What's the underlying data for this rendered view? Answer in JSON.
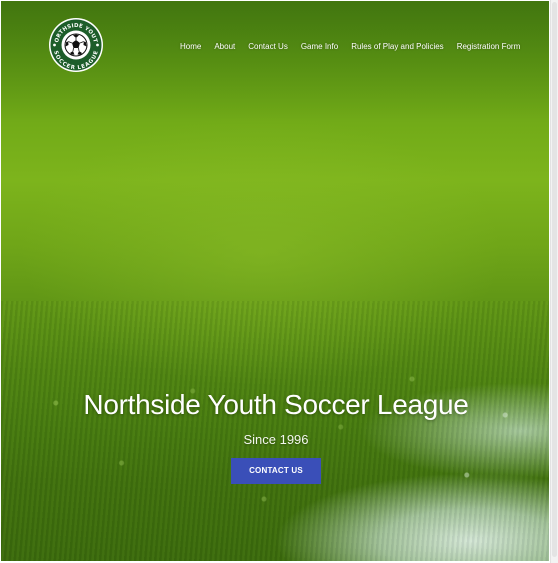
{
  "header": {
    "logo_text_top": "NORTHSIDE YOUTH",
    "logo_text_bottom": "SOCCER LEAGUE"
  },
  "nav": {
    "items": [
      {
        "label": "Home"
      },
      {
        "label": "About"
      },
      {
        "label": "Contact Us"
      },
      {
        "label": "Game Info"
      },
      {
        "label": "Rules of Play and Policies"
      },
      {
        "label": "Registration Form"
      }
    ]
  },
  "hero": {
    "title": "Northside Youth Soccer League",
    "subtitle": "Since 1996",
    "cta_label": "CONTACT US"
  },
  "colors": {
    "logo_ring": "#1d5d2a",
    "logo_accent": "#ffffff",
    "cta_background": "#3a4fb8",
    "grass_light": "#7db41c",
    "grass_dark": "#3a690d"
  },
  "icons": {
    "logo": "soccer-ball-logo-icon"
  }
}
